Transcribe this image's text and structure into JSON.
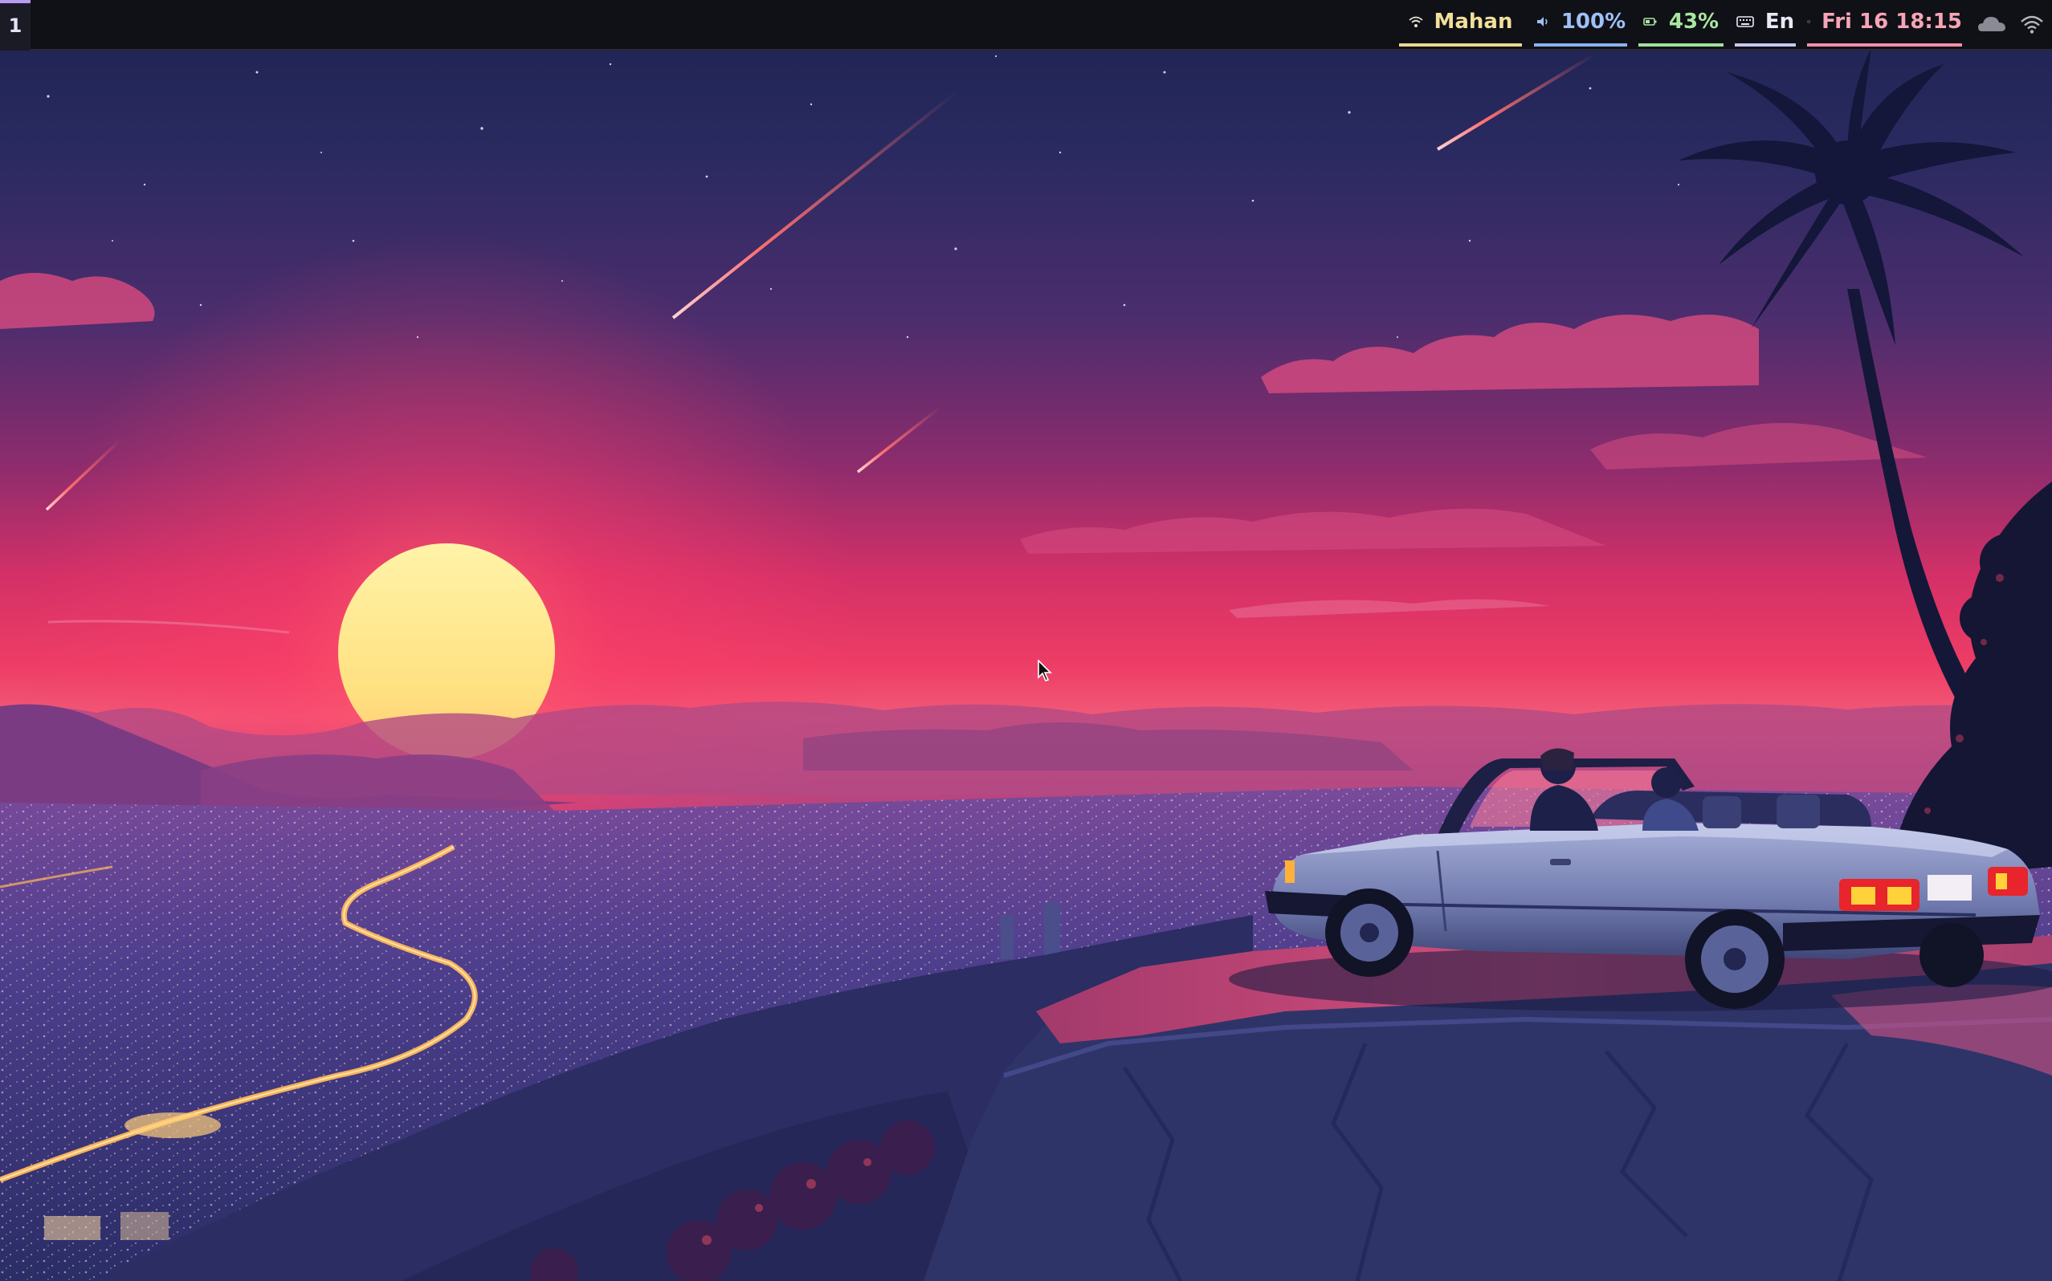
{
  "topbar": {
    "workspace": "1",
    "network": {
      "label": "Mahan",
      "icon": "wifi-icon"
    },
    "volume": {
      "label": "100%",
      "icon": "speaker-icon"
    },
    "battery": {
      "label": "43%",
      "icon": "battery-icon"
    },
    "keyboard": {
      "label": "En",
      "icon": "keyboard-icon"
    },
    "clock": {
      "label": "Fri 16 18:15",
      "icon": "clock-icon"
    },
    "tray": [
      {
        "icon": "cloud-weather-icon"
      },
      {
        "icon": "wifi-tray-icon"
      }
    ]
  },
  "colors": {
    "bar_background": "#101117",
    "network_accent": "#e8d88e",
    "volume_accent": "#8ab1f0",
    "battery_accent": "#9ee39a",
    "keyboard_accent": "#c4c8f0",
    "clock_accent": "#ef8fa6",
    "workspace_accent": "#b79cf0"
  },
  "desktop": {
    "wallpaper": "synthwave-sunset-cliff-convertible"
  }
}
